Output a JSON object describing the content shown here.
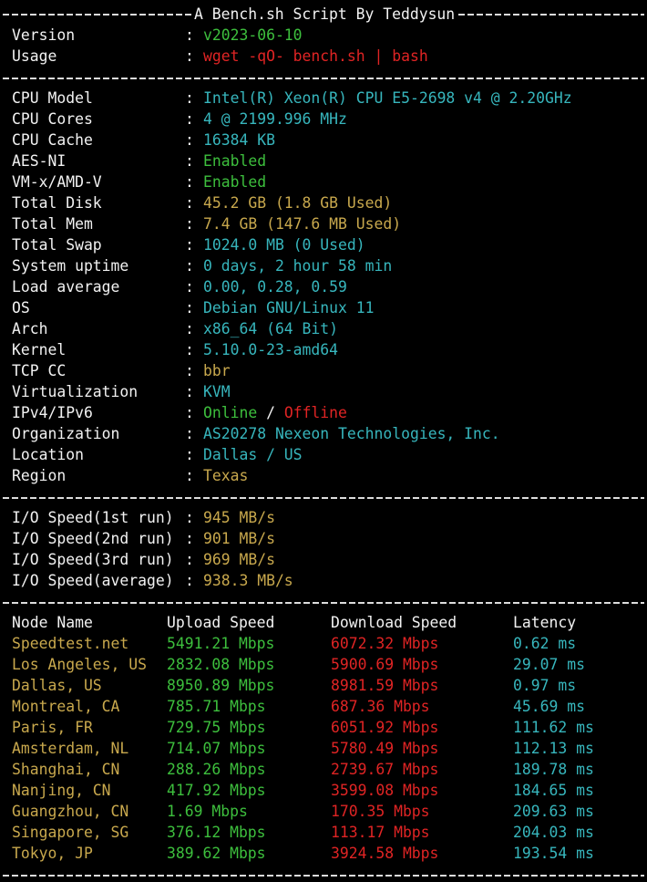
{
  "header": {
    "title": "A Bench.sh Script By Teddysun",
    "version_label": "Version",
    "version_value": "v2023-06-10",
    "usage_label": "Usage",
    "usage_value": "wget -qO- bench.sh | bash"
  },
  "colon": ":",
  "system": [
    {
      "label": "CPU Model",
      "value": "Intel(R) Xeon(R) CPU E5-2698 v4 @ 2.20GHz",
      "color": "cyan"
    },
    {
      "label": "CPU Cores",
      "value": "4 @ 2199.996 MHz",
      "color": "cyan"
    },
    {
      "label": "CPU Cache",
      "value": "16384 KB",
      "color": "cyan"
    },
    {
      "label": "AES-NI",
      "value": "Enabled",
      "color": "green"
    },
    {
      "label": "VM-x/AMD-V",
      "value": "Enabled",
      "color": "green"
    },
    {
      "label": "Total Disk",
      "value": "45.2 GB (1.8 GB Used)",
      "color": "yellow"
    },
    {
      "label": "Total Mem",
      "value": "7.4 GB (147.6 MB Used)",
      "color": "yellow"
    },
    {
      "label": "Total Swap",
      "value": "1024.0 MB (0 Used)",
      "color": "cyan"
    },
    {
      "label": "System uptime",
      "value": "0 days, 2 hour 58 min",
      "color": "cyan"
    },
    {
      "label": "Load average",
      "value": "0.00, 0.28, 0.59",
      "color": "cyan"
    },
    {
      "label": "OS",
      "value": "Debian GNU/Linux 11",
      "color": "cyan"
    },
    {
      "label": "Arch",
      "value": "x86_64 (64 Bit)",
      "color": "cyan"
    },
    {
      "label": "Kernel",
      "value": "5.10.0-23-amd64",
      "color": "cyan"
    },
    {
      "label": "TCP CC",
      "value": "bbr",
      "color": "yellow"
    },
    {
      "label": "Virtualization",
      "value": "KVM",
      "color": "cyan"
    }
  ],
  "network": {
    "ipv_label": "IPv4/IPv6",
    "ipv4_status": "Online",
    "ipv_slash": " / ",
    "ipv6_status": "Offline",
    "org_label": "Organization",
    "org_value": "AS20278 Nexeon Technologies, Inc.",
    "location_label": "Location",
    "location_value": "Dallas / US",
    "region_label": "Region",
    "region_value": "Texas"
  },
  "io": [
    {
      "label": "I/O Speed(1st run)",
      "value": "945 MB/s"
    },
    {
      "label": "I/O Speed(2nd run)",
      "value": "901 MB/s"
    },
    {
      "label": "I/O Speed(3rd run)",
      "value": "969 MB/s"
    },
    {
      "label": "I/O Speed(average)",
      "value": "938.3 MB/s"
    }
  ],
  "speedtest": {
    "headers": {
      "node": "Node Name",
      "upload": "Upload Speed",
      "download": "Download Speed",
      "latency": "Latency"
    },
    "rows": [
      {
        "node": "Speedtest.net",
        "upload": "5491.21 Mbps",
        "download": "6072.32 Mbps",
        "latency": "0.62 ms"
      },
      {
        "node": "Los Angeles, US",
        "upload": "2832.08 Mbps",
        "download": "5900.69 Mbps",
        "latency": "29.07 ms"
      },
      {
        "node": "Dallas, US",
        "upload": "8950.89 Mbps",
        "download": "8981.59 Mbps",
        "latency": "0.97 ms"
      },
      {
        "node": "Montreal, CA",
        "upload": "785.71 Mbps",
        "download": "687.36 Mbps",
        "latency": "45.69 ms"
      },
      {
        "node": "Paris, FR",
        "upload": "729.75 Mbps",
        "download": "6051.92 Mbps",
        "latency": "111.62 ms"
      },
      {
        "node": "Amsterdam, NL",
        "upload": "714.07 Mbps",
        "download": "5780.49 Mbps",
        "latency": "112.13 ms"
      },
      {
        "node": "Shanghai, CN",
        "upload": "288.26 Mbps",
        "download": "2739.67 Mbps",
        "latency": "189.78 ms"
      },
      {
        "node": "Nanjing, CN",
        "upload": "417.92 Mbps",
        "download": "3599.08 Mbps",
        "latency": "184.65 ms"
      },
      {
        "node": "Guangzhou, CN",
        "upload": "1.69 Mbps",
        "download": "170.35 Mbps",
        "latency": "209.63 ms"
      },
      {
        "node": "Singapore, SG",
        "upload": "376.12 Mbps",
        "download": "113.17 Mbps",
        "latency": "204.03 ms"
      },
      {
        "node": "Tokyo, JP",
        "upload": "389.62 Mbps",
        "download": "3924.58 Mbps",
        "latency": "193.54 ms"
      }
    ]
  },
  "colors": {
    "green": "#3dbf3d",
    "red": "#e02424",
    "cyan": "#37b6bd",
    "yellow": "#c8a84d",
    "background": "#000000",
    "text": "#f2f2f2"
  }
}
